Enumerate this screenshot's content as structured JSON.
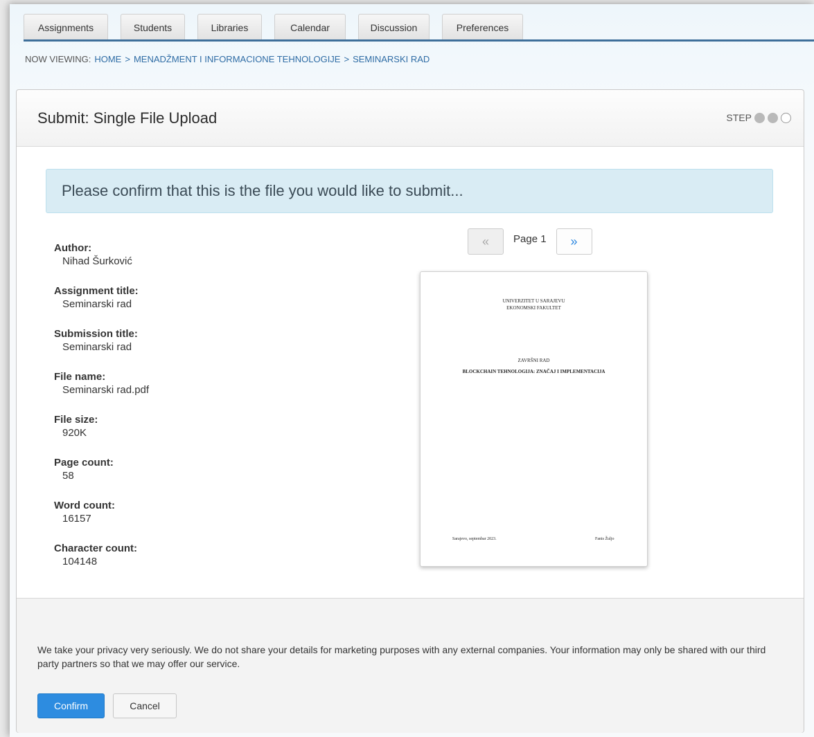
{
  "tabs": [
    "Assignments",
    "Students",
    "Libraries",
    "Calendar",
    "Discussion",
    "Preferences"
  ],
  "breadcrumb": {
    "label": "NOW VIEWING:",
    "home": "HOME",
    "sep": ">",
    "course": "MENADŽMENT I INFORMACIONE TEHNOLOGIJE",
    "current": "SEMINARSKI RAD"
  },
  "panel": {
    "title": "Submit: Single File Upload",
    "step_label": "STEP",
    "steps": {
      "current": 2,
      "total": 3
    }
  },
  "notice": "Please confirm that this is the file you would like to submit...",
  "meta": [
    {
      "label": "Author:",
      "value": "Nihad Šurković"
    },
    {
      "label": "Assignment title:",
      "value": "Seminarski rad"
    },
    {
      "label": "Submission title:",
      "value": "Seminarski rad"
    },
    {
      "label": "File name:",
      "value": "Seminarski rad.pdf"
    },
    {
      "label": "File size:",
      "value": "920K"
    },
    {
      "label": "Page count:",
      "value": "58"
    },
    {
      "label": "Word count:",
      "value": "16157"
    },
    {
      "label": "Character count:",
      "value": "104148"
    }
  ],
  "pager": {
    "prev": "«",
    "page_label": "Page 1",
    "next": "»"
  },
  "preview": {
    "university": "UNIVERZITET U SARAJEVU",
    "faculty": "EKONOMSKI FAKULTET",
    "doc_type": "ZAVRŠNI RAD",
    "doc_title": "BLOCKCHAIN TEHNOLOGIJA: ZNAČAJ I IMPLEMENTACIJA",
    "place_date": "Sarajevo, septembar 2023.",
    "author": "Fanis Žuljo"
  },
  "privacy": "We take your privacy very seriously. We do not share your details for marketing purposes with any external companies. Your information may only be shared with our third party partners so that we may offer our service.",
  "buttons": {
    "confirm": "Confirm",
    "cancel": "Cancel"
  },
  "colors": {
    "accent": "#2d8ce0",
    "tab_underline": "#3e6f9a",
    "notice_bg": "#d9ecf4"
  }
}
